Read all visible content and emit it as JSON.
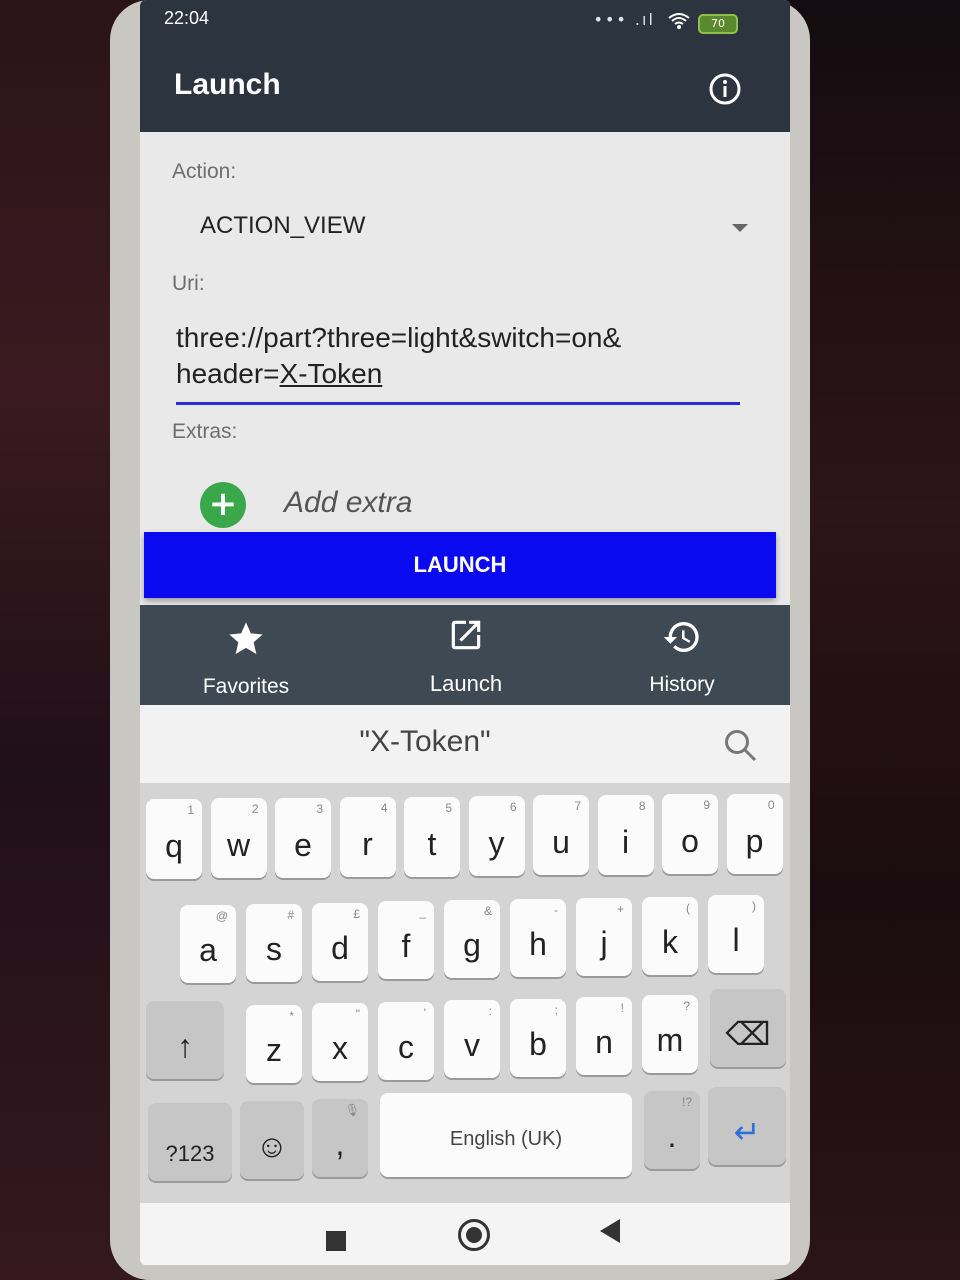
{
  "status_bar": {
    "time": "22:04",
    "indicators": "••• .ıl",
    "battery": "70"
  },
  "app_bar": {
    "title": "Launch",
    "info_icon": "info-icon"
  },
  "form": {
    "action_label": "Action:",
    "action_value": "ACTION_VIEW",
    "uri_label": "Uri:",
    "uri_value_line1": "three://part?three=light&switch=on&",
    "uri_value_line2_prefix": "header=",
    "uri_value_line2_token": "X-Token",
    "extras_label": "Extras:",
    "add_extra_label": "Add extra",
    "add_extra_symbol": "+",
    "launch_button": "LAUNCH"
  },
  "bottom_nav": {
    "items": [
      {
        "label": "Favorites",
        "icon": "star-icon"
      },
      {
        "label": "Launch",
        "icon": "open-in-new-icon"
      },
      {
        "label": "History",
        "icon": "history-icon"
      }
    ],
    "selected": "Launch"
  },
  "keyboard": {
    "suggestion": "\"X-Token\"",
    "row1": [
      {
        "key": "q",
        "hint": "1"
      },
      {
        "key": "w",
        "hint": "2"
      },
      {
        "key": "e",
        "hint": "3"
      },
      {
        "key": "r",
        "hint": "4"
      },
      {
        "key": "t",
        "hint": "5"
      },
      {
        "key": "y",
        "hint": "6"
      },
      {
        "key": "u",
        "hint": "7"
      },
      {
        "key": "i",
        "hint": "8"
      },
      {
        "key": "o",
        "hint": "9"
      },
      {
        "key": "p",
        "hint": "0"
      }
    ],
    "row2": [
      {
        "key": "a",
        "hint": "@"
      },
      {
        "key": "s",
        "hint": "#"
      },
      {
        "key": "d",
        "hint": "£"
      },
      {
        "key": "f",
        "hint": "_"
      },
      {
        "key": "g",
        "hint": "&"
      },
      {
        "key": "h",
        "hint": "-"
      },
      {
        "key": "j",
        "hint": "+"
      },
      {
        "key": "k",
        "hint": "("
      },
      {
        "key": "l",
        "hint": ")"
      }
    ],
    "row3": [
      {
        "key": "z",
        "hint": "*"
      },
      {
        "key": "x",
        "hint": "\""
      },
      {
        "key": "c",
        "hint": "'"
      },
      {
        "key": "v",
        "hint": ":"
      },
      {
        "key": "b",
        "hint": ";"
      },
      {
        "key": "n",
        "hint": "!"
      },
      {
        "key": "m",
        "hint": "?"
      }
    ],
    "shift": "↑",
    "backspace": "⌫",
    "symbols": "?123",
    "emoji": "☺",
    "comma": ",",
    "mic_hint": "🎙",
    "space": "English (UK)",
    "period": ".",
    "period_hint": "!?",
    "enter": "↵"
  }
}
